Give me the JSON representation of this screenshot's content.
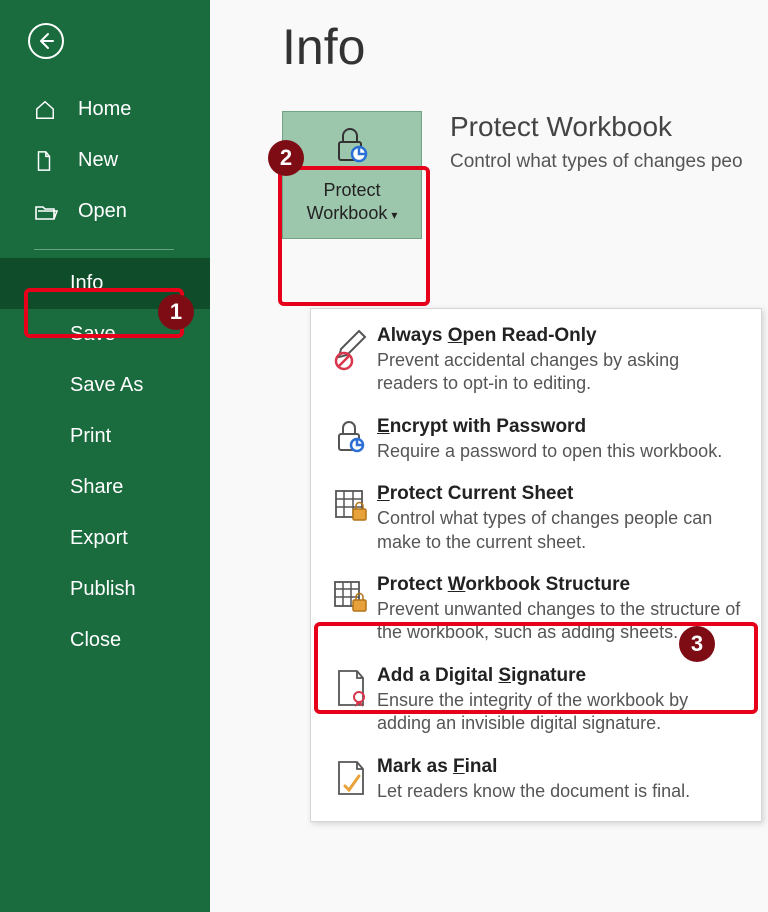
{
  "sidebar": {
    "items": [
      {
        "label": "Home",
        "icon": "home"
      },
      {
        "label": "New",
        "icon": "file"
      },
      {
        "label": "Open",
        "icon": "folder"
      },
      {
        "label": "Info",
        "selected": true
      },
      {
        "label": "Save"
      },
      {
        "label": "Save As"
      },
      {
        "label": "Print"
      },
      {
        "label": "Share"
      },
      {
        "label": "Export"
      },
      {
        "label": "Publish"
      },
      {
        "label": "Close"
      }
    ]
  },
  "main": {
    "title": "Info",
    "protect_button_label_l1": "Protect",
    "protect_button_label_l2": "Workbook",
    "protect_section_title": "Protect Workbook",
    "protect_section_desc": "Control what types of changes peo"
  },
  "menu": {
    "items": [
      {
        "title": "Always Open Read-Only",
        "desc": "Prevent accidental changes by asking readers to opt-in to editing."
      },
      {
        "title": "Encrypt with Password",
        "desc": "Require a password to open this workbook."
      },
      {
        "title": "Protect Current Sheet",
        "desc": "Control what types of changes people can make to the current sheet."
      },
      {
        "title": "Protect Workbook Structure",
        "desc": "Prevent unwanted changes to the structure of the workbook, such as adding sheets."
      },
      {
        "title": "Add a Digital Signature",
        "desc": "Ensure the integrity of the workbook by adding an invisible digital signature."
      },
      {
        "title": "Mark as Final",
        "desc": "Let readers know the document is final."
      }
    ]
  },
  "annotations": {
    "badge1": "1",
    "badge2": "2",
    "badge3": "3"
  }
}
